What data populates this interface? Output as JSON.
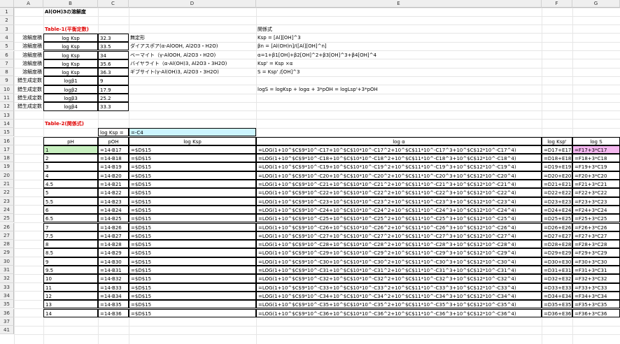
{
  "columns": [
    "A",
    "B",
    "C",
    "D",
    "E",
    "F",
    "G"
  ],
  "title": "Al(OH)3の溶解度",
  "table1": {
    "label": "Table-1(平衡定数)",
    "rows": [
      {
        "a": "溶解度積",
        "b": "log Ksp",
        "c": "32.3",
        "d": "無定形"
      },
      {
        "a": "溶解度積",
        "b": "log Ksp",
        "c": "33.5",
        "d": "ダイアスポア(α-AlOOH, Al2O3・H2O)"
      },
      {
        "a": "溶解度積",
        "b": "log Ksp",
        "c": "34",
        "d": "ベーマイト（γ-AlOOH, Al2O3・H2O)"
      },
      {
        "a": "溶解度積",
        "b": "log Ksp",
        "c": "35.6",
        "d": "バイヤライト（α-Al(OH)3, Al2O3・3H2O)"
      },
      {
        "a": "溶解度積",
        "b": "log Ksp",
        "c": "36.3",
        "d": "ギブサイト(γ-Al(OH)3, Al2O3・3H2O)"
      },
      {
        "a": "錯生成定数",
        "b": "logβ1",
        "c": "9",
        "d": ""
      },
      {
        "a": "錯生成定数",
        "b": "logβ2",
        "c": "17.9",
        "d": ""
      },
      {
        "a": "錯生成定数",
        "b": "logβ3",
        "c": "25.2",
        "d": ""
      },
      {
        "a": "錯生成定数",
        "b": "logβ4",
        "c": "33.3",
        "d": ""
      }
    ]
  },
  "relations": {
    "label": "関係式",
    "lines": [
      "Ksp = [Al][OH]^3",
      "βn = [Al(OH)n]/([Al][OH]^n]",
      "α=1+β1[OH]+β2[OH]^2+β3[OH]^3+β4[OH]^4",
      "Ksp' = Ksp ×α",
      "S = Ksp' /[OH]^3",
      "",
      "logS = logKsp + logα + 3*pOH = logLsp'+3*pOH"
    ]
  },
  "table2": {
    "label": "Table-2(関係式)",
    "logksp_label": "log Ksp =",
    "logksp_formula": "=-C4",
    "headers": [
      "pH",
      "pOH",
      "log Ksp",
      "log α",
      "log Ksp'",
      "log S"
    ],
    "rows": [
      [
        "1",
        "=14-B17",
        "=$D$15",
        "=LOG(1+10^$C$9*10^-C17+10^$C$10*10^-C17^2+10^$C$11*10^-C17^3+10^$C$12*10^-C17^4)",
        "=D17+E17",
        "=F17+3*C17"
      ],
      [
        "2",
        "=14-B18",
        "=$D$15",
        "=LOG(1+10^$C$9*10^-C18+10^$C$10*10^-C18^2+10^$C$11*10^-C18^3+10^$C$12*10^-C18^4)",
        "=D18+E18",
        "=F18+3*C18"
      ],
      [
        "3",
        "=14-B19",
        "=$D$15",
        "=LOG(1+10^$C$9*10^-C19+10^$C$10*10^-C19^2+10^$C$11*10^-C19^3+10^$C$12*10^-C19^4)",
        "=D19+E19",
        "=F19+3*C19"
      ],
      [
        "4",
        "=14-B20",
        "=$D$15",
        "=LOG(1+10^$C$9*10^-C20+10^$C$10*10^-C20^2+10^$C$11*10^-C20^3+10^$C$12*10^-C20^4)",
        "=D20+E20",
        "=F20+3*C20"
      ],
      [
        "4.5",
        "=14-B21",
        "=$D$15",
        "=LOG(1+10^$C$9*10^-C21+10^$C$10*10^-C21^2+10^$C$11*10^-C21^3+10^$C$12*10^-C21^4)",
        "=D21+E21",
        "=F21+3*C21"
      ],
      [
        "5",
        "=14-B22",
        "=$D$15",
        "=LOG(1+10^$C$9*10^-C22+10^$C$10*10^-C22^2+10^$C$11*10^-C22^3+10^$C$12*10^-C22^4)",
        "=D22+E22",
        "=F22+3*C22"
      ],
      [
        "5.5",
        "=14-B23",
        "=$D$15",
        "=LOG(1+10^$C$9*10^-C23+10^$C$10*10^-C23^2+10^$C$11*10^-C23^3+10^$C$12*10^-C23^4)",
        "=D23+E23",
        "=F23+3*C23"
      ],
      [
        "6",
        "=14-B24",
        "=$D$15",
        "=LOG(1+10^$C$9*10^-C24+10^$C$10*10^-C24^2+10^$C$11*10^-C24^3+10^$C$12*10^-C24^4)",
        "=D24+E24",
        "=F24+3*C24"
      ],
      [
        "6.5",
        "=14-B25",
        "=$D$15",
        "=LOG(1+10^$C$9*10^-C25+10^$C$10*10^-C25^2+10^$C$11*10^-C25^3+10^$C$12*10^-C25^4)",
        "=D25+E25",
        "=F25+3*C25"
      ],
      [
        "7",
        "=14-B26",
        "=$D$15",
        "=LOG(1+10^$C$9*10^-C26+10^$C$10*10^-C26^2+10^$C$11*10^-C26^3+10^$C$12*10^-C26^4)",
        "=D26+E26",
        "=F26+3*C26"
      ],
      [
        "7.5",
        "=14-B27",
        "=$D$15",
        "=LOG(1+10^$C$9*10^-C27+10^$C$10*10^-C27^2+10^$C$11*10^-C27^3+10^$C$12*10^-C27^4)",
        "=D27+E27",
        "=F27+3*C27"
      ],
      [
        "8",
        "=14-B28",
        "=$D$15",
        "=LOG(1+10^$C$9*10^-C28+10^$C$10*10^-C28^2+10^$C$11*10^-C28^3+10^$C$12*10^-C28^4)",
        "=D28+E28",
        "=F28+3*C28"
      ],
      [
        "8.5",
        "=14-B29",
        "=$D$15",
        "=LOG(1+10^$C$9*10^-C29+10^$C$10*10^-C29^2+10^$C$11*10^-C29^3+10^$C$12*10^-C29^4)",
        "=D29+E29",
        "=F29+3*C29"
      ],
      [
        "9",
        "=14-B30",
        "=$D$15",
        "=LOG(1+10^$C$9*10^-C30+10^$C$10*10^-C30^2+10^$C$11*10^-C30^3+10^$C$12*10^-C30^4)",
        "=D30+E30",
        "=F30+3*C30"
      ],
      [
        "9.5",
        "=14-B31",
        "=$D$15",
        "=LOG(1+10^$C$9*10^-C31+10^$C$10*10^-C31^2+10^$C$11*10^-C31^3+10^$C$12*10^-C31^4)",
        "=D31+E31",
        "=F31+3*C31"
      ],
      [
        "10",
        "=14-B32",
        "=$D$15",
        "=LOG(1+10^$C$9*10^-C32+10^$C$10*10^-C32^2+10^$C$11*10^-C32^3+10^$C$12*10^-C32^4)",
        "=D32+E32",
        "=F32+3*C32"
      ],
      [
        "11",
        "=14-B33",
        "=$D$15",
        "=LOG(1+10^$C$9*10^-C33+10^$C$10*10^-C33^2+10^$C$11*10^-C33^3+10^$C$12*10^-C33^4)",
        "=D33+E33",
        "=F33+3*C33"
      ],
      [
        "12",
        "=14-B34",
        "=$D$15",
        "=LOG(1+10^$C$9*10^-C34+10^$C$10*10^-C34^2+10^$C$11*10^-C34^3+10^$C$12*10^-C34^4)",
        "=D34+E34",
        "=F34+3*C34"
      ],
      [
        "13",
        "=14-B35",
        "=$D$15",
        "=LOG(1+10^$C$9*10^-C35+10^$C$10*10^-C35^2+10^$C$11*10^-C35^3+10^$C$12*10^-C35^4)",
        "=D35+E35",
        "=F35+3*C35"
      ],
      [
        "14",
        "=14-B36",
        "=$D$15",
        "=LOG(1+10^$C$9*10^-C36+10^$C$10*10^-C36^2+10^$C$11*10^-C36^3+10^$C$12*10^-C36^4)",
        "=D36+E36",
        "=F36+3*C36"
      ]
    ]
  },
  "visible_rows": [
    "1",
    "2",
    "3",
    "4",
    "5",
    "6",
    "7",
    "8",
    "9",
    "10",
    "11",
    "12",
    "13",
    "14",
    "15",
    "16",
    "17",
    "18",
    "19",
    "20",
    "21",
    "22",
    "23",
    "24",
    "25",
    "26",
    "27",
    "28",
    "29",
    "30",
    "31",
    "32",
    "33",
    "34",
    "35",
    "36",
    "37",
    "41"
  ],
  "colors": {
    "cyan": "#ccf5ff",
    "green": "#c8f0c0",
    "pink": "#f5b8f0",
    "red": "#e00000"
  }
}
